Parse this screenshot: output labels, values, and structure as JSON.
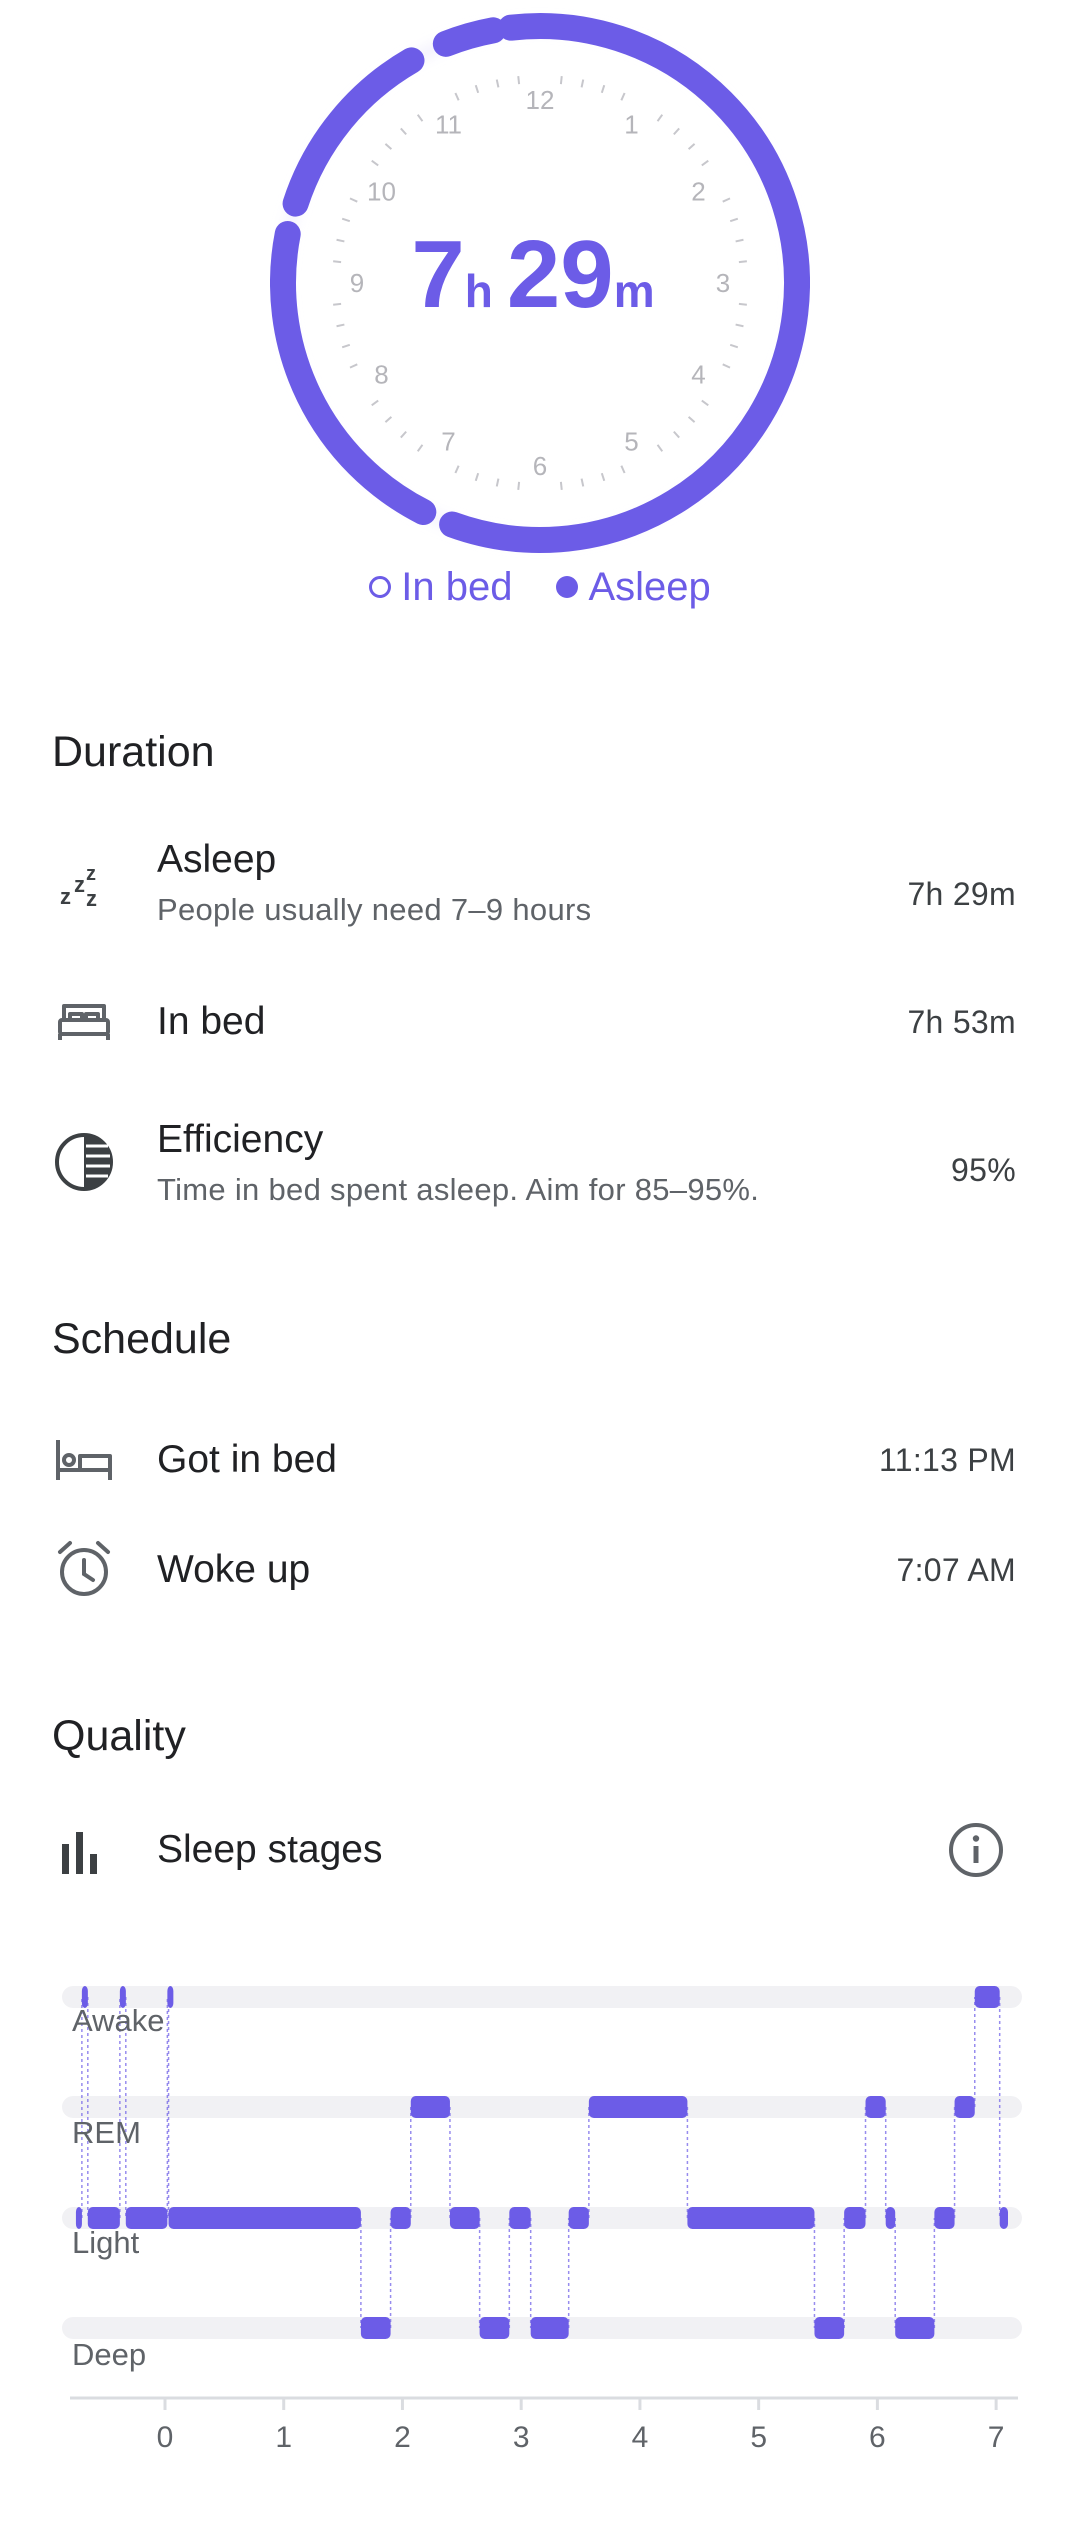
{
  "clock": {
    "hours": "7",
    "hours_unit": "h",
    "minutes": "29",
    "minutes_unit": "m",
    "numbers": [
      "12",
      "1",
      "2",
      "3",
      "4",
      "5",
      "6",
      "7",
      "8",
      "9",
      "10",
      "11"
    ],
    "accent": "#6C5CE7"
  },
  "legend": {
    "in_bed": "In bed",
    "asleep": "Asleep"
  },
  "duration": {
    "title": "Duration",
    "asleep": {
      "label": "Asleep",
      "sub": "People usually need 7–9 hours",
      "value": "7h 29m",
      "icon": "zzz-icon"
    },
    "in_bed": {
      "label": "In bed",
      "value": "7h 53m",
      "icon": "bed-icon"
    },
    "efficiency": {
      "label": "Efficiency",
      "sub": "Time in bed spent asleep. Aim for 85–95%.",
      "value": "95%",
      "icon": "half-circle-icon"
    }
  },
  "schedule": {
    "title": "Schedule",
    "got_in_bed": {
      "label": "Got in bed",
      "value": "11:13 PM",
      "icon": "bed-icon"
    },
    "woke_up": {
      "label": "Woke up",
      "value": "7:07 AM",
      "icon": "alarm-clock-icon"
    }
  },
  "quality": {
    "title": "Quality",
    "sleep_stages": {
      "label": "Sleep stages",
      "icon": "bar-chart-icon",
      "info_icon": "info-icon"
    }
  },
  "chart_data": {
    "type": "line",
    "title": "Sleep stages",
    "stages": [
      "Awake",
      "REM",
      "Light",
      "Deep"
    ],
    "x_ticks": [
      "0",
      "1",
      "2",
      "3",
      "4",
      "5",
      "6",
      "7"
    ],
    "xlim": [
      -0.8,
      7.1
    ],
    "segments": [
      {
        "stage": "Light",
        "start": -0.75,
        "end": -0.7
      },
      {
        "stage": "Awake",
        "start": -0.7,
        "end": -0.65
      },
      {
        "stage": "Light",
        "start": -0.65,
        "end": -0.38
      },
      {
        "stage": "Awake",
        "start": -0.38,
        "end": -0.33
      },
      {
        "stage": "Light",
        "start": -0.33,
        "end": 0.02
      },
      {
        "stage": "Awake",
        "start": 0.02,
        "end": 0.03
      },
      {
        "stage": "Light",
        "start": 0.03,
        "end": 1.65
      },
      {
        "stage": "Deep",
        "start": 1.65,
        "end": 1.9
      },
      {
        "stage": "Light",
        "start": 1.9,
        "end": 2.07
      },
      {
        "stage": "REM",
        "start": 2.07,
        "end": 2.4
      },
      {
        "stage": "Light",
        "start": 2.4,
        "end": 2.65
      },
      {
        "stage": "Deep",
        "start": 2.65,
        "end": 2.9
      },
      {
        "stage": "Light",
        "start": 2.9,
        "end": 3.08
      },
      {
        "stage": "Deep",
        "start": 3.08,
        "end": 3.4
      },
      {
        "stage": "Light",
        "start": 3.4,
        "end": 3.57
      },
      {
        "stage": "REM",
        "start": 3.57,
        "end": 4.4
      },
      {
        "stage": "Light",
        "start": 4.4,
        "end": 5.47
      },
      {
        "stage": "Deep",
        "start": 5.47,
        "end": 5.72
      },
      {
        "stage": "Light",
        "start": 5.72,
        "end": 5.9
      },
      {
        "stage": "REM",
        "start": 5.9,
        "end": 6.07
      },
      {
        "stage": "Light",
        "start": 6.07,
        "end": 6.15
      },
      {
        "stage": "Deep",
        "start": 6.15,
        "end": 6.48
      },
      {
        "stage": "Light",
        "start": 6.48,
        "end": 6.65
      },
      {
        "stage": "REM",
        "start": 6.65,
        "end": 6.82
      },
      {
        "stage": "Awake",
        "start": 6.82,
        "end": 7.03
      },
      {
        "stage": "Light",
        "start": 7.03,
        "end": 7.1
      }
    ],
    "color": "#6C5CE7",
    "track_color": "#F1F1F4"
  }
}
